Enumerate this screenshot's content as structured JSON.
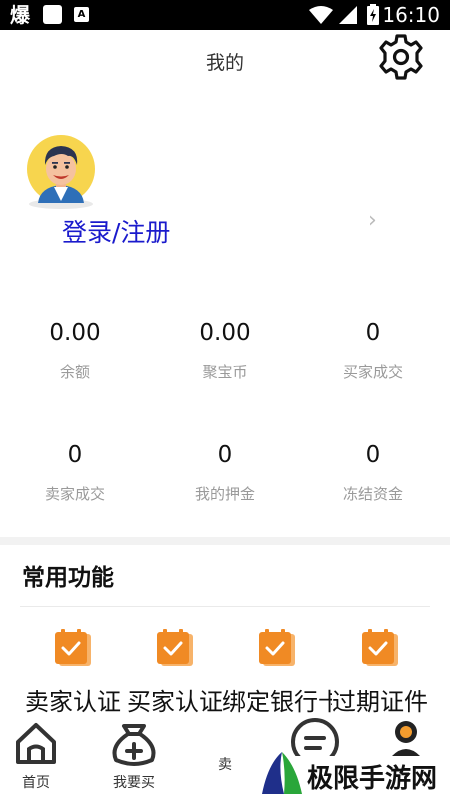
{
  "status_bar": {
    "app_glyph": "爆",
    "notif_glyph": "A",
    "time": "16:10"
  },
  "header": {
    "title": "我的"
  },
  "profile": {
    "login_label": "登录/注册"
  },
  "stats": [
    {
      "value": "0.00",
      "label": "余额"
    },
    {
      "value": "0.00",
      "label": "聚宝币"
    },
    {
      "value": "0",
      "label": "买家成交"
    },
    {
      "value": "0",
      "label": "卖家成交"
    },
    {
      "value": "0",
      "label": "我的押金"
    },
    {
      "value": "0",
      "label": "冻结资金"
    }
  ],
  "functions": {
    "title": "常用功能",
    "items": [
      {
        "label": "卖家认证"
      },
      {
        "label": "买家认证"
      },
      {
        "label": "绑定银行卡"
      },
      {
        "label": "过期证件"
      }
    ]
  },
  "bottom_nav": {
    "items": [
      {
        "label": "首页",
        "icon": "home-icon"
      },
      {
        "label": "我要买",
        "icon": "buy-bag-icon"
      },
      {
        "label": "卖",
        "icon": ""
      },
      {
        "label": "",
        "icon": "message-icon"
      },
      {
        "label": "",
        "icon": "profile-icon"
      }
    ]
  },
  "watermark": {
    "text": "极限手游网"
  },
  "colors": {
    "accent_orange": "#f39c2e",
    "link_blue": "#1a1acc",
    "label_gray": "#9a9a9a"
  }
}
